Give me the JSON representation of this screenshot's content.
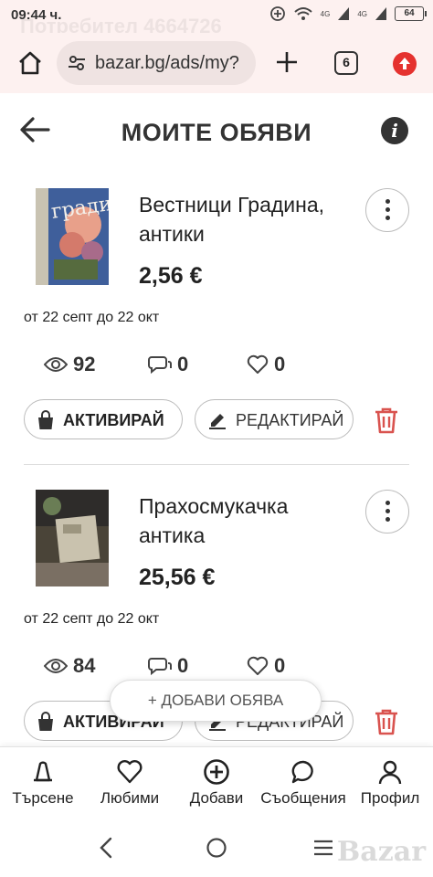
{
  "status_bar": {
    "time": "09:44 ч.",
    "ghost_text": "Потребител 4664726",
    "battery": "64",
    "signal_label": "4G"
  },
  "browser": {
    "url": "bazar.bg/ads/my?",
    "tab_count": "6"
  },
  "header": {
    "title": "МОИТЕ ОБЯВИ",
    "info_symbol": "i"
  },
  "listings": [
    {
      "title": "Вестници Градина, антики",
      "price": "2,56 €",
      "dates": "от 22 септ до 22 окт",
      "views": "92",
      "messages": "0",
      "likes": "0",
      "activate_label": "АКТИВИРАЙ",
      "edit_label": "РЕДАКТИРАЙ"
    },
    {
      "title": "Прахосмукачка антика",
      "price": "25,56 €",
      "dates": "от 22 септ до 22 окт",
      "views": "84",
      "messages": "0",
      "likes": "0",
      "activate_label": "АКТИВИРАЙ",
      "edit_label": "РЕДАКТИРАЙ"
    }
  ],
  "fab": {
    "label": "+ ДОБАВИ ОБЯВА"
  },
  "bottom_nav": {
    "items": [
      {
        "label": "Търсене",
        "icon": "bell-search-icon"
      },
      {
        "label": "Любими",
        "icon": "heart-icon"
      },
      {
        "label": "Добави",
        "icon": "plus-circle-icon"
      },
      {
        "label": "Съобщения",
        "icon": "chat-icon"
      },
      {
        "label": "Профил",
        "icon": "user-icon"
      }
    ]
  },
  "watermark": "Bazar",
  "colors": {
    "accent": "#e5322f",
    "trash": "#d9534f",
    "chrome_bg": "#fdf1f0"
  }
}
